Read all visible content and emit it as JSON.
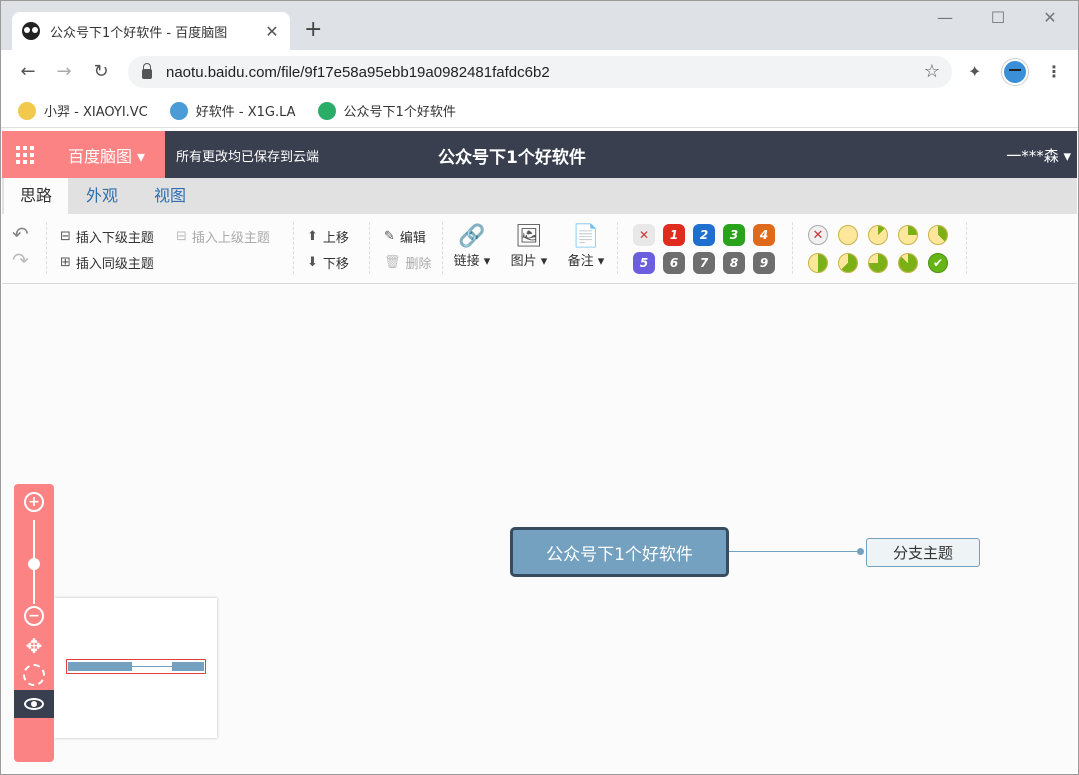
{
  "browser": {
    "tab_title": "公众号下1个好软件 - 百度脑图",
    "tab_close": "✕",
    "new_tab": "+",
    "url": "naotu.baidu.com/file/9f17e58a95ebb19a09824​81fafdc6b2",
    "bookmarks": [
      {
        "label": "小羿 - XIAOYI.VC",
        "color": "#f2c94c"
      },
      {
        "label": "好软件 - X1G.LA",
        "color": "#4a9bd6"
      },
      {
        "label": "公众号下1个好软件",
        "color": "#2aae67"
      }
    ]
  },
  "app": {
    "brand": "百度脑图 ▾",
    "saved_status": "所有更改均已保存到云端",
    "doc_title": "公众号下1个好软件",
    "user": "一***森 ▾",
    "accent": "#fc8383",
    "header_bg": "#393f4f"
  },
  "tabs": [
    "思路",
    "外观",
    "视图"
  ],
  "ribbon": {
    "insert_child": "插入下级主题",
    "insert_parent": "插入上级主题",
    "insert_sibling": "插入同级主题",
    "move_up": "上移",
    "move_down": "下移",
    "edit": "编辑",
    "delete": "删除",
    "link": "链接 ▾",
    "image": "图片 ▾",
    "note": "备注 ▾",
    "priorities": [
      {
        "label": "✕",
        "color": "#e8e8e8",
        "fg": "#c33"
      },
      {
        "label": "1",
        "color": "#e02b1f",
        "fg": "#fff"
      },
      {
        "label": "2",
        "color": "#1f6fd0",
        "fg": "#fff"
      },
      {
        "label": "3",
        "color": "#29a31b",
        "fg": "#fff"
      },
      {
        "label": "4",
        "color": "#e06a1c",
        "fg": "#fff"
      },
      {
        "label": "5",
        "color": "#6b5fe0",
        "fg": "#fff"
      },
      {
        "label": "6",
        "color": "#6e6e6e",
        "fg": "#fff"
      },
      {
        "label": "7",
        "color": "#6e6e6e",
        "fg": "#fff"
      },
      {
        "label": "8",
        "color": "#6e6e6e",
        "fg": "#fff"
      },
      {
        "label": "9",
        "color": "#6e6e6e",
        "fg": "#fff"
      }
    ],
    "progress": [
      {
        "type": "clear",
        "label": "✕"
      },
      {
        "type": "level",
        "fraction": 0.0
      },
      {
        "type": "level",
        "fraction": 0.125
      },
      {
        "type": "level",
        "fraction": 0.25
      },
      {
        "type": "level",
        "fraction": 0.375
      },
      {
        "type": "level",
        "fraction": 0.5
      },
      {
        "type": "level",
        "fraction": 0.625
      },
      {
        "type": "level",
        "fraction": 0.75
      },
      {
        "type": "level",
        "fraction": 0.875
      },
      {
        "type": "done",
        "label": "✔"
      }
    ]
  },
  "mindmap": {
    "root": "公众号下1个好软件",
    "branch": "分支主题",
    "node_color": "#73a1bf"
  },
  "zoom": {
    "plus": "+",
    "minus": "−",
    "move": "✥"
  }
}
